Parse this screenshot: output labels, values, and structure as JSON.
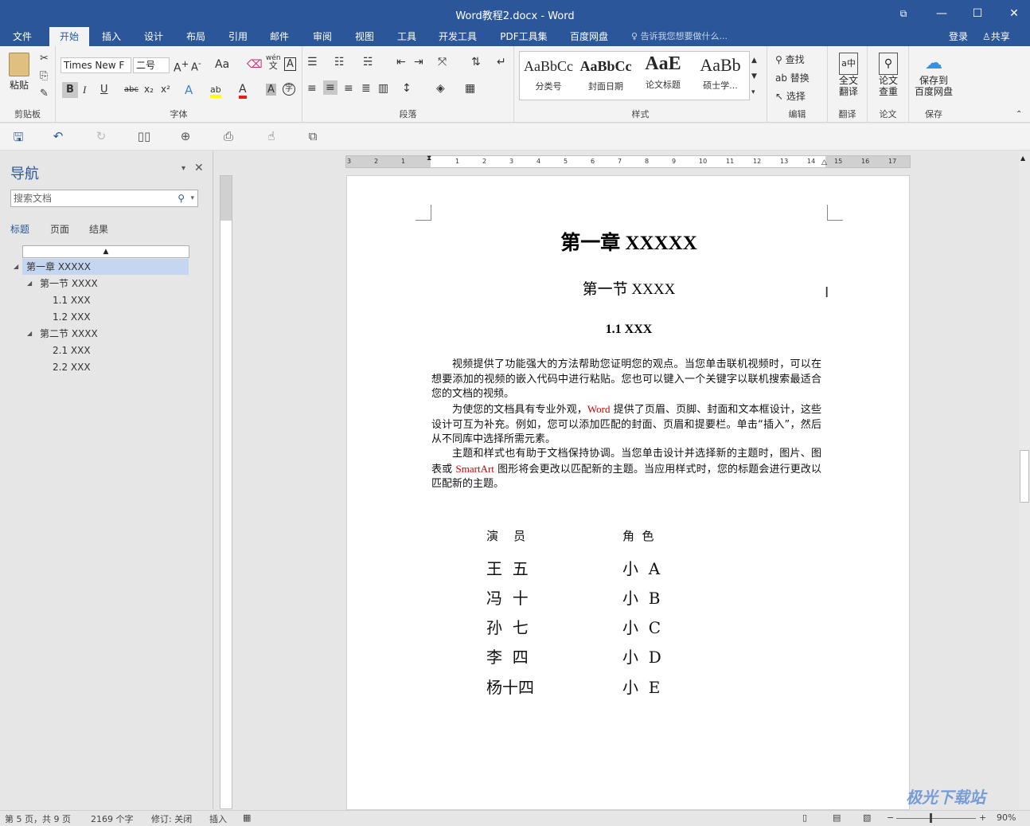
{
  "window": {
    "title": "Word教程2.docx - Word"
  },
  "tabs": [
    "文件",
    "开始",
    "插入",
    "设计",
    "布局",
    "引用",
    "邮件",
    "审阅",
    "视图",
    "工具",
    "开发工具",
    "PDF工具集",
    "百度网盘"
  ],
  "tell_me": "告诉我您想要做什么...",
  "account": {
    "login": "登录",
    "share": "共享"
  },
  "ribbon": {
    "clipboard": {
      "paste": "粘贴",
      "label": "剪贴板"
    },
    "font": {
      "name": "Times New F",
      "size": "二号",
      "label": "字体",
      "case": "Aa",
      "phonetic_top": "wén",
      "phonetic_bottom": "文",
      "char_border": "A",
      "bold": "B",
      "italic": "I",
      "underline": "U",
      "strike": "abc",
      "sub": "x₂",
      "sup": "x²",
      "effects": "A",
      "highlight": "ab",
      "color": "A",
      "shade": "A",
      "enclose": "字"
    },
    "paragraph": {
      "label": "段落"
    },
    "styles": {
      "label": "样式",
      "items": [
        {
          "preview": "AaBbCc",
          "name": "分类号"
        },
        {
          "preview": "AaBbCc",
          "name": "封面日期"
        },
        {
          "preview": "AaE",
          "name": "论文标题"
        },
        {
          "preview": "AaBb",
          "name": "硕士学..."
        }
      ]
    },
    "editing": {
      "find": "查找",
      "replace": "替换",
      "select": "选择",
      "label": "编辑"
    },
    "translate": {
      "btn": "全文\n翻译",
      "label": "翻译"
    },
    "paper": {
      "btn": "论文\n查重",
      "label": "论文"
    },
    "save": {
      "btn": "保存到\n百度网盘",
      "label": "保存"
    }
  },
  "nav": {
    "title": "导航",
    "search_placeholder": "搜索文档",
    "tabs": [
      "标题",
      "页面",
      "结果"
    ],
    "headings": [
      {
        "text": "第一章 XXXXX",
        "level": 1
      },
      {
        "text": "第一节 XXXX",
        "level": 2
      },
      {
        "text": "1.1 XXX",
        "level": 3
      },
      {
        "text": "1.2 XXX",
        "level": 3
      },
      {
        "text": "第二节 XXXX",
        "level": 2
      },
      {
        "text": "2.1 XXX",
        "level": 3
      },
      {
        "text": "2.2 XXX",
        "level": 3
      }
    ]
  },
  "doc": {
    "h1": "第一章  XXXXX",
    "h2": "第一节  XXXX",
    "h3": "1.1 XXX",
    "p1": "视频提供了功能强大的方法帮助您证明您的观点。当您单击联机视频时，可以在想要添加的视频的嵌入代码中进行粘贴。您也可以键入一个关键字以联机搜索最适合您的文档的视频。",
    "p2a": "为使您的文档具有专业外观，",
    "p2word": "Word",
    "p2b": " 提供了页眉、页脚、封面和文本框设计，这些设计可互为补充。例如，您可以添加匹配的封面、页眉和提要栏。单击“插入”，然后从不同库中选择所需元素。",
    "p3a": "主题和样式也有助于文档保持协调。当您单击设计并选择新的主题时，图片、图表或 ",
    "p3smart": "SmartArt",
    "p3b": " 图形将会更改以匹配新的主题。当应用样式时，您的标题会进行更改以匹配新的主题。",
    "table": {
      "headers": [
        "演    员",
        "角  色"
      ],
      "rows": [
        [
          "王  五",
          "小  A"
        ],
        [
          "冯  十",
          "小  B"
        ],
        [
          "孙  七",
          "小  C"
        ],
        [
          "李  四",
          "小  D"
        ],
        [
          "杨十四",
          "小  E"
        ]
      ]
    }
  },
  "ruler": {
    "h_numbers": [
      "3",
      "2",
      "1",
      "1",
      "2",
      "3",
      "4",
      "5",
      "6",
      "7",
      "8",
      "9",
      "10",
      "11",
      "12",
      "13",
      "14",
      "15",
      "16",
      "17"
    ]
  },
  "status": {
    "page": "第 5 页，共 9 页",
    "words": "2169 个字",
    "track": "修订: 关闭",
    "mode": "插入",
    "zoom": "90%"
  },
  "watermark": "极光下载站"
}
